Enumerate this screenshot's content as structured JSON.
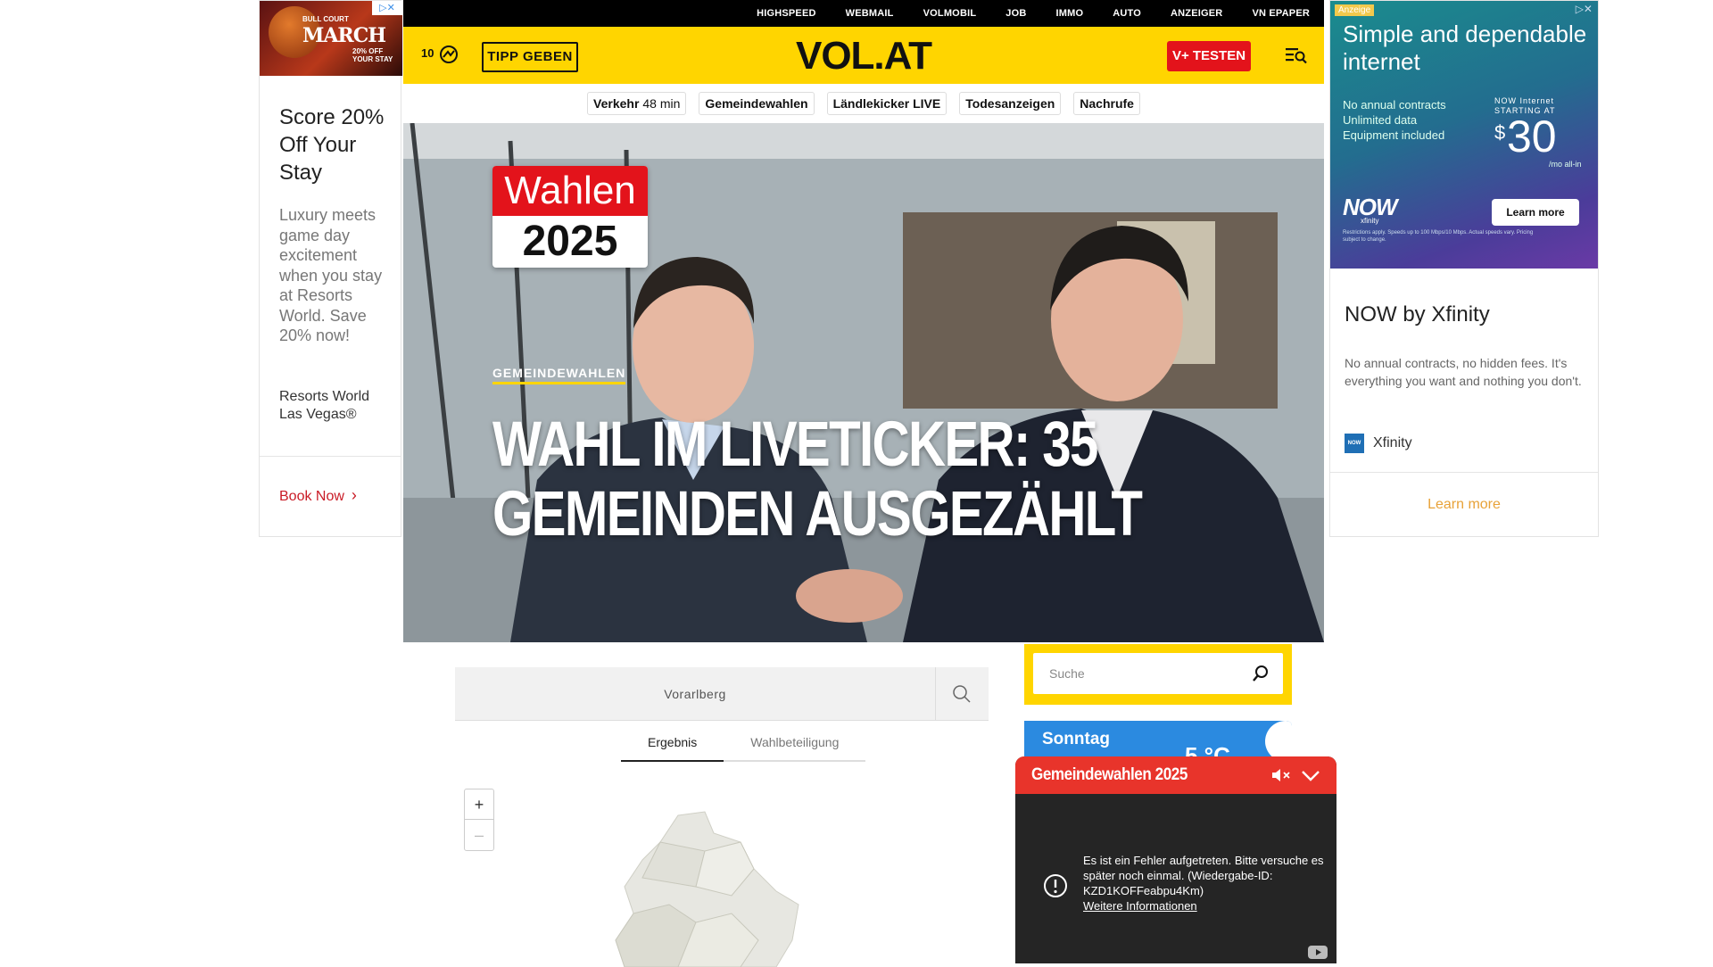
{
  "left_ad": {
    "banner": {
      "line1": "BULL COURT",
      "line2": "MARCH",
      "discount": "20% OFF YOUR STAY",
      "ad_choices": "▷✕"
    },
    "title": "Score 20% Off Your Stay",
    "body": "Luxury meets game day excitement when you stay at Resorts World. Save 20% now!",
    "brand": "Resorts World Las Vegas®",
    "cta": "Book Now",
    "cta_icon": "chevron-right-icon"
  },
  "top_nav": {
    "items": [
      "HIGHSPEED",
      "WEBMAIL",
      "VOLMOBIL",
      "JOB",
      "IMMO",
      "AUTO",
      "ANZEIGER",
      "VN EPAPER"
    ]
  },
  "header": {
    "temperature": "10",
    "weather_icon": "weather-icon",
    "tipp_label": "TIPP GEBEN",
    "logo": "VOL.AT",
    "vplus_label": "V+ TESTEN",
    "menu_icon": "menu-search-icon",
    "brand_color": "#ffd500",
    "vplus_color": "#e3131b"
  },
  "quick_links": {
    "traffic": {
      "label": "Verkehr",
      "value": "48 min"
    },
    "items": [
      "Gemeindewahlen",
      "Ländlekicker LIVE",
      "Todesanzeigen",
      "Nachrufe"
    ]
  },
  "hero": {
    "badge_top": "Wahlen",
    "badge_bottom": "2025",
    "kicker": "GEMEINDEWAHLEN",
    "headline": "WAHL IM LIVETICKER: 35 GEMEINDEN AUSGEZÄHLT"
  },
  "election_widget": {
    "search_value": "Vorarlberg",
    "search_icon": "search-icon",
    "tabs": [
      {
        "label": "Ergebnis",
        "active": true
      },
      {
        "label": "Wahlbeteiligung",
        "active": false
      }
    ],
    "zoom_in": "+",
    "zoom_out": "–"
  },
  "sidebar": {
    "search_placeholder": "Suche",
    "search_icon": "search-icon",
    "weather_day": "Sonntag",
    "weather_temp": "5 °C"
  },
  "video_popup": {
    "title": "Gemeindewahlen 2025",
    "mute_icon": "mute-icon",
    "collapse_icon": "chevron-down-icon",
    "error_message": "Es ist ein Fehler aufgetreten. Bitte versuche es später noch einmal. (Wiedergabe-ID: KZD1KOFFeabpu4Km)",
    "error_link": "Weitere Informationen",
    "header_color": "#e8342b"
  },
  "right_ad": {
    "label": "Anzeige",
    "ad_choices": "▷✕",
    "banner_headline": "Simple and dependable internet",
    "features": [
      "No annual contracts",
      "Unlimited data",
      "Equipment included"
    ],
    "price_label": "NOW Internet STARTING AT",
    "price": "30",
    "price_suffix": "/mo all-in",
    "logo": "NOW",
    "logo_sub": "xfinity",
    "banner_cta": "Learn more",
    "fine_print": "Restrictions apply. Speeds up to 100 Mbps/10 Mbps. Actual speeds vary. Pricing subject to change.",
    "title": "NOW by Xfinity",
    "body": "No annual contracts, no hidden fees. It's everything you want and nothing you don't.",
    "brand": "Xfinity",
    "brand_logo": "NOW",
    "cta": "Learn more"
  }
}
